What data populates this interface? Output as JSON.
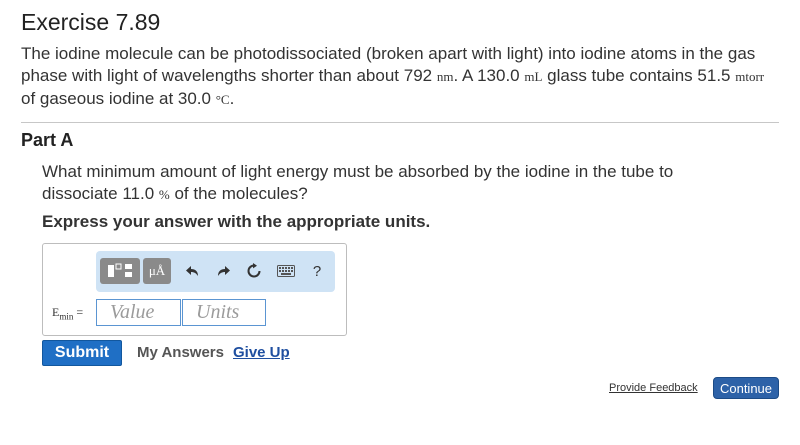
{
  "exercise": {
    "title": "Exercise 7.89"
  },
  "problem": {
    "p1": "The iodine molecule can be photodissociated (broken apart with light) into iodine atoms in the gas phase with light of wavelengths shorter than about 792 ",
    "u1": "nm",
    "p2": ". A 130.0 ",
    "u2": "mL",
    "p3": " glass tube contains 51.5 ",
    "u3": "mtorr",
    "p4": " of gaseous iodine at 30.0 ",
    "u4": "°C",
    "p5": "."
  },
  "part": {
    "title": "Part A"
  },
  "question": {
    "q1": "What minimum amount of light energy must be absorbed by the iodine in the tube to dissociate 11.0 ",
    "q_unit": "%",
    "q2": " of the molecules?"
  },
  "instruction": "Express your answer with the appropriate units.",
  "toolbar": {
    "units_label": "μÅ",
    "undo_icon": "undo-arrow",
    "redo_icon": "redo-arrow",
    "reset_icon": "reset-circle",
    "keyboard_icon": "keyboard",
    "help_label": "?"
  },
  "answer": {
    "var_name": "E",
    "var_sub": "min",
    "equals": "=",
    "value_placeholder": "Value",
    "units_placeholder": "Units"
  },
  "actions": {
    "submit_label": "Submit",
    "my_answers_label": "My Answers",
    "give_up_label": "Give Up"
  },
  "footer": {
    "feedback_label": "Provide Feedback",
    "continue_label": "Continue"
  },
  "colors": {
    "toolbar_bg": "#cfe3f5",
    "submit_bg": "#1f6fc5",
    "continue_bg": "#2d62a8",
    "link": "#1f4fa0"
  }
}
